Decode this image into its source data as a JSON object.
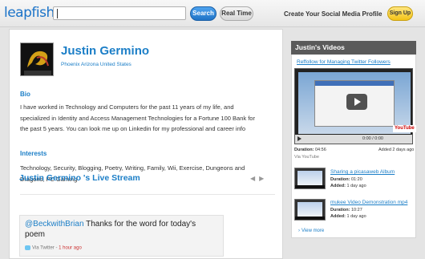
{
  "header": {
    "logo_text": "leapfish",
    "search": {
      "value": "",
      "placeholder": ""
    },
    "search_button": "Search",
    "realtime_button": "Real Time",
    "cta_text": "Create Your Social Media Profile",
    "signup_button": "Sign Up"
  },
  "profile": {
    "name": "Justin Germino",
    "location": "Phoenix Arizona United States",
    "bio_heading": "Bio",
    "bio_text": "I have worked in Technology and Computers for the past 11 years of my life, and specialized in Identity and Access Management Technologies for a Fortune 100 Bank for the past 5 years. You can look me up on Linkedin for my professional and career info",
    "interests_heading": "Interests",
    "interests_text": "Technology, Security, Blogging, Poetry, Writing, Family, Wii, Exercise, Dungeons and Dragons, PC Gaming"
  },
  "stream": {
    "heading": "Justin Germino 's Live Stream",
    "post": {
      "user": "@BeckwithBrian",
      "text": " Thanks for the word for today's poem",
      "via": "Via Twitter - ",
      "ago": "1 hour ago"
    }
  },
  "videos": {
    "heading": "Justin's Videos",
    "featured": {
      "title": "Reffollow for Managing Twitter Followers",
      "time_display": "0:00 / 0:00",
      "yt_badge": "YouTube",
      "duration_label": "Duration:",
      "duration": "04:56",
      "added": "Added 2 days ago",
      "via": "Via YouTube"
    },
    "list": [
      {
        "title": "Sharing a picasaweb Album",
        "duration_label": "Duration:",
        "duration": "01:20",
        "added_label": "Added:",
        "added": "1 day ago"
      },
      {
        "title": "mukee Video Demonstration mp4",
        "duration_label": "Duration:",
        "duration": "10:27",
        "added_label": "Added:",
        "added": "1 day ago"
      }
    ],
    "view_more": "View more"
  },
  "colors": {
    "accent": "#1b7ec7",
    "signup": "#f3c317",
    "header_bg": "#5a5a5a"
  }
}
